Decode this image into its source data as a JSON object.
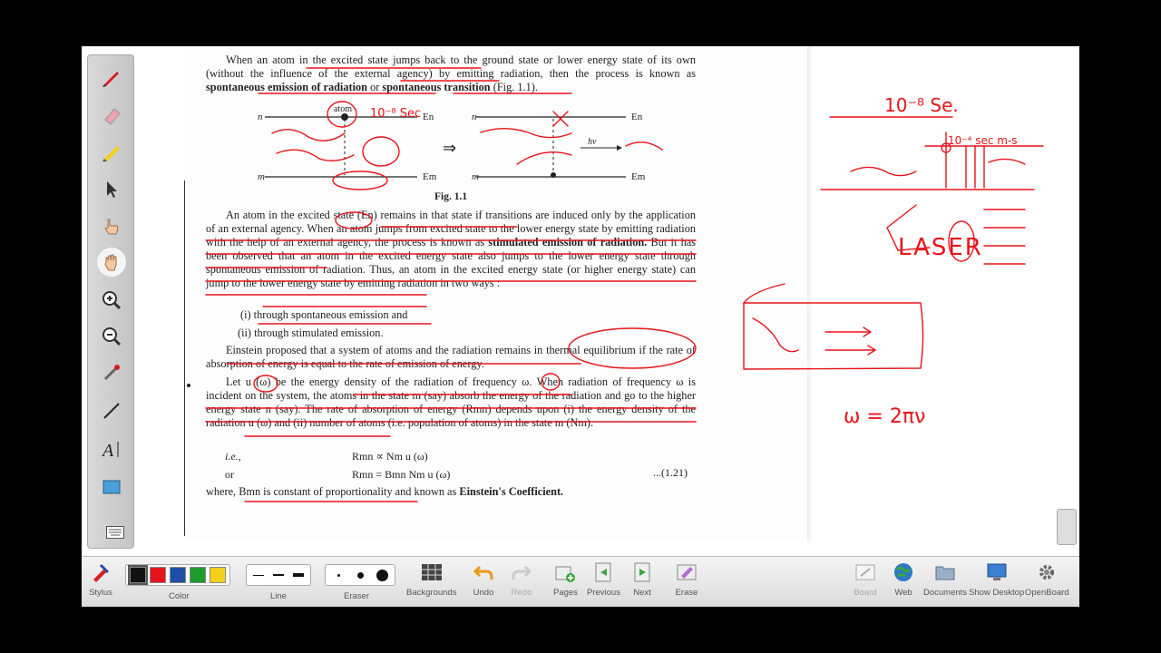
{
  "document": {
    "para1": {
      "t1": "When an atom in the excited state jumps back to the ground state or lower energy state of its own (without the influence of the external agency) by emitting radiation, then the process is known as ",
      "b1": "spontaneous emission of radiation",
      "t2": " or ",
      "b2": "spontaneous transition",
      "t3": " (Fig. 1.1)."
    },
    "figure": {
      "caption": "Fig. 1.1",
      "atom_label": "atom",
      "level_n": "n",
      "level_m": "m",
      "En": "En",
      "Em": "Em",
      "hv": "hν",
      "arrow": "⇒"
    },
    "para2": {
      "t1": "An atom in the excited state (En) remains in that state if transitions are induced only by the application of an external agency. When an atom jumps from excited state to the lower energy state by emitting radiation with the help of an external agency, the process is known as ",
      "b1": "stimulated emission of radiation.",
      "t2": " But it has been observed that an atom in the excited energy state also jumps to the lower energy state through spontaneous emission of radiation. Thus, an atom in the excited energy state (or higher energy state) can jump to the lower energy state by emitting radiation in two ways :"
    },
    "list": [
      "(i)  through spontaneous emission and",
      "(ii)  through stimulated emission."
    ],
    "para3": "Einstein proposed that a system of atoms and the radiation remains in thermal equilibrium if the rate of absorption of energy is equal to the rate of emission of energy.",
    "para4": "Let u (ω) be the energy density of the radiation of frequency ω. When radiation of frequency ω is incident on the system, the atoms in the state m (say) absorb the energy of the radiation and go to the higher energy state n (say). The rate of absorption of energy (Rmn) depends upon (i) the energy density of the radiation u (ω) and (ii) number of atoms (i.e. population of atoms) in the state m (Nm).",
    "eq1_prefix": "i.e.,",
    "eq1": "Rmn ∝ Nm u (ω)",
    "eq2_prefix": "or",
    "eq2": "Rmn = Bmn Nm u (ω)",
    "eq2_number": "...(1.21)",
    "para5": {
      "t1": "where, Bmn is constant of proportionality and known as ",
      "b1": "Einstein's Coefficient."
    }
  },
  "annotations": {
    "n1": "10⁻⁸ Sec",
    "n2": "10⁻⁸ Se.",
    "n3": "10⁻⁴ sec m-s",
    "laser": "LASER",
    "formula": "ω = 2πν"
  },
  "toolbar": {
    "stylus": "Stylus",
    "color": "Color",
    "line": "Line",
    "eraser": "Eraser",
    "backgrounds": "Backgrounds",
    "undo": "Undo",
    "redo": "Redo",
    "pages": "Pages",
    "previous": "Previous",
    "next": "Next",
    "erase": "Erase",
    "board": "Board",
    "web": "Web",
    "documents": "Documents",
    "show_desktop": "Show Desktop",
    "openboard": "OpenBoard"
  },
  "colors": {
    "ink_red": "#e8141b",
    "swatch_black": "#111111",
    "swatch_red": "#e8141b",
    "swatch_blue": "#1f4fa8",
    "swatch_green": "#1e9a2e",
    "swatch_yellow": "#f4d01d"
  }
}
